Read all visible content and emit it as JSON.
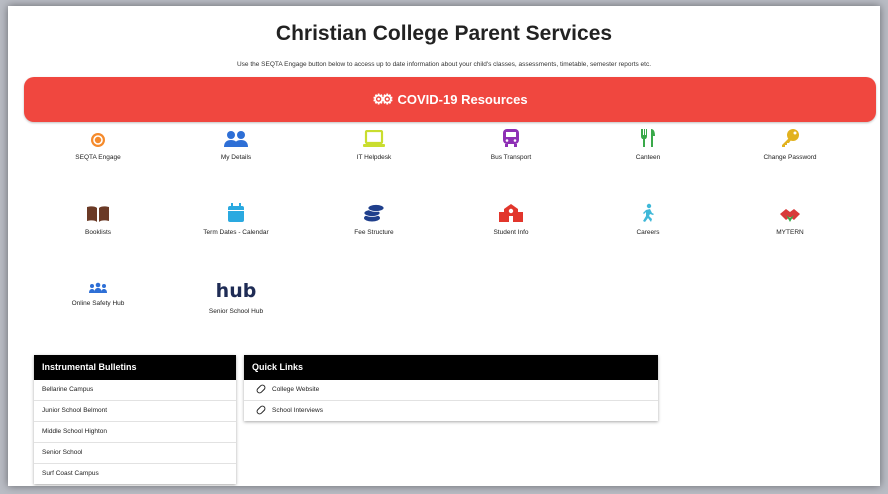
{
  "header": {
    "title": "Christian College Parent Services",
    "subtitle": "Use the SEQTA Engage button below to access up to date information about your child's classes, assessments, timetable, semester reports etc."
  },
  "covid_button": {
    "label": "COVID-19 Resources",
    "icon": "gears-icon"
  },
  "tiles": [
    {
      "label": "SEQTA Engage",
      "icon": "seqta-logo-icon",
      "color": "#f58a2b"
    },
    {
      "label": "My Details",
      "icon": "users-icon",
      "color": "#2e6fd6"
    },
    {
      "label": "IT Helpdesk",
      "icon": "laptop-icon",
      "color": "#c9dd2e"
    },
    {
      "label": "Bus Transport",
      "icon": "bus-icon",
      "color": "#8e2fb5"
    },
    {
      "label": "Canteen",
      "icon": "utensils-icon",
      "color": "#3aa94a"
    },
    {
      "label": "Change Password",
      "icon": "key-icon",
      "color": "#e2b21f"
    },
    {
      "label": "Booklists",
      "icon": "book-icon",
      "color": "#6b3a26"
    },
    {
      "label": "Term Dates - Calendar",
      "icon": "calendar-icon",
      "color": "#2aa9e0"
    },
    {
      "label": "Fee Structure",
      "icon": "coins-icon",
      "color": "#1f3f8c"
    },
    {
      "label": "Student Info",
      "icon": "school-icon",
      "color": "#e2362c"
    },
    {
      "label": "Careers",
      "icon": "running-person-icon",
      "color": "#3fb8d8"
    },
    {
      "label": "MYTERN",
      "icon": "mytern-logo-icon",
      "color": "#d93a3a"
    },
    {
      "label": "Online Safety Hub",
      "icon": "people-group-icon",
      "color": "#2e6fd6"
    },
    {
      "label": "Senior School Hub",
      "icon": "hub-logo-icon",
      "text": "hub",
      "color": "#1f2c55"
    }
  ],
  "instrumental": {
    "title": "Instrumental Bulletins",
    "items": [
      "Bellarine Campus",
      "Junior School Belmont",
      "Middle School Highton",
      "Senior School",
      "Surf Coast Campus"
    ]
  },
  "quicklinks": {
    "title": "Quick Links",
    "items": [
      "College Website",
      "School Interviews"
    ]
  }
}
